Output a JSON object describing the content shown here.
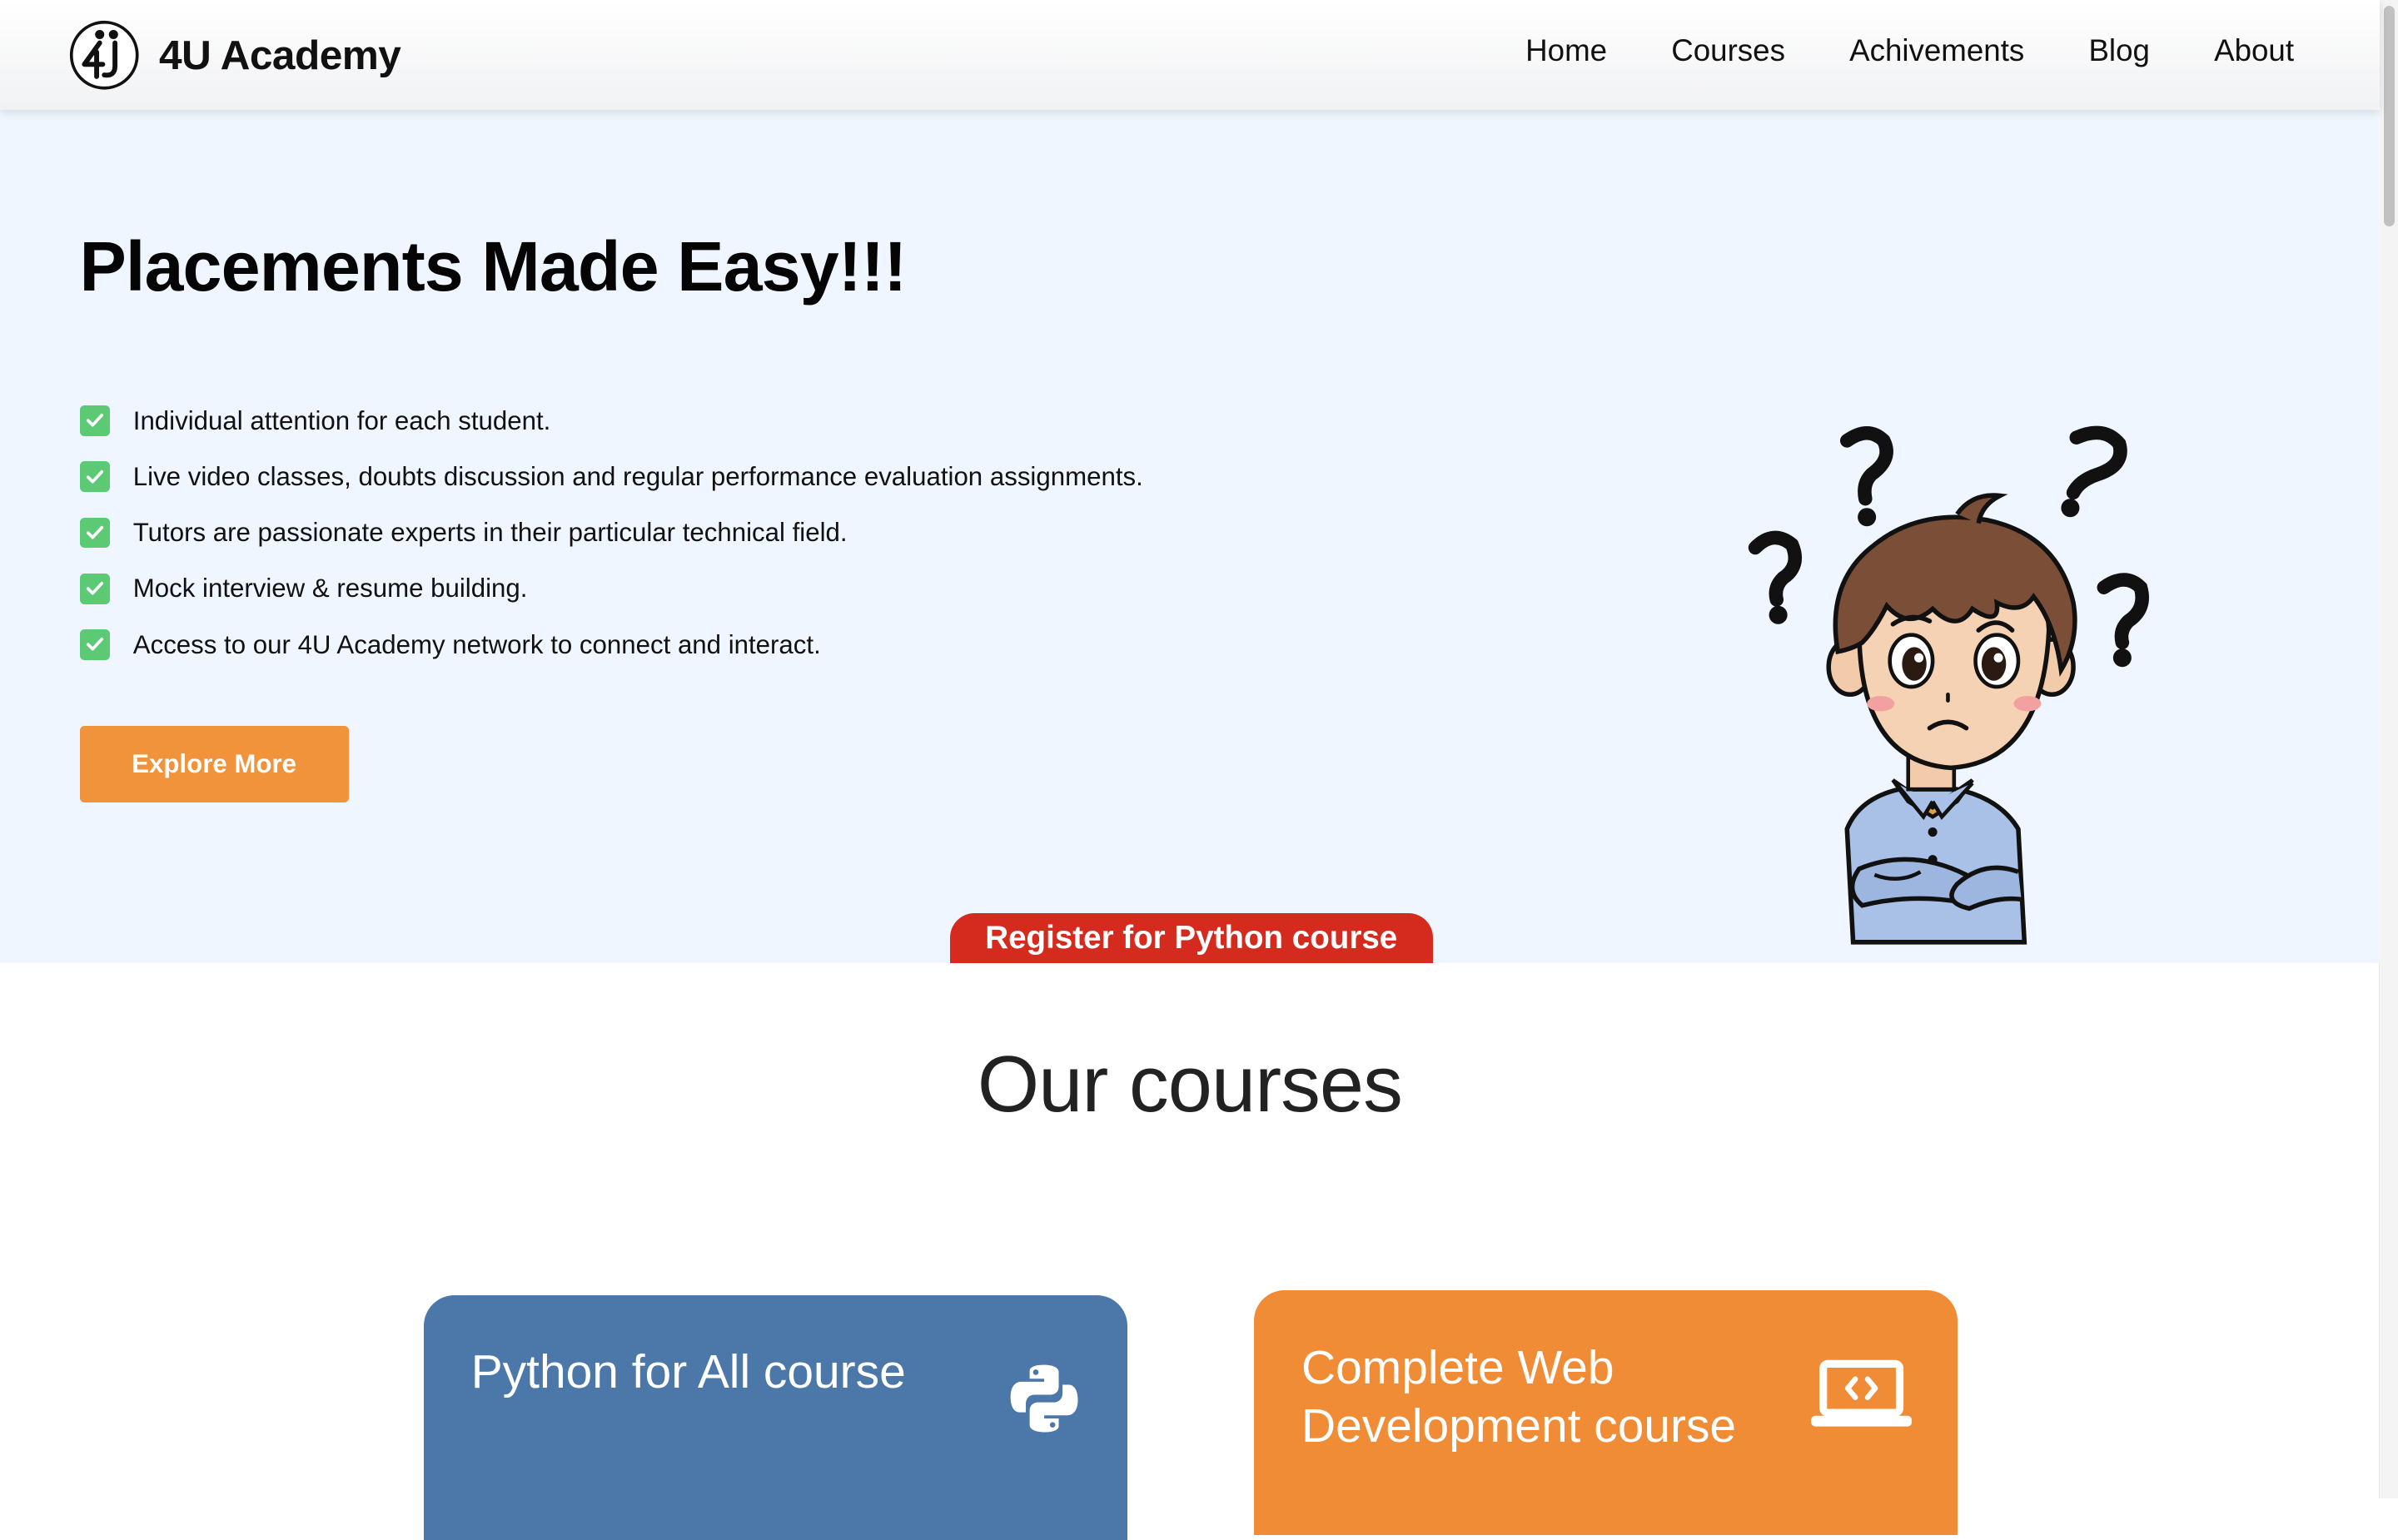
{
  "brand": {
    "name": "4U Academy",
    "logo_icon": "4u-logo-icon"
  },
  "nav": {
    "items": [
      "Home",
      "Courses",
      "Achivements",
      "Blog",
      "About"
    ]
  },
  "hero": {
    "title": "Placements Made Easy!!!",
    "features": [
      "Individual attention for each student.",
      "Live video classes, doubts discussion and regular performance evaluation assignments.",
      "Tutors are passionate experts in their particular technical field.",
      "Mock interview & resume building.",
      "Access to our 4U Academy network to connect and interact."
    ],
    "cta_label": "Explore More",
    "register_label": "Register for Python course"
  },
  "courses": {
    "heading": "Our courses",
    "cards": [
      {
        "title": "Python for All course",
        "icon": "python-icon"
      },
      {
        "title": "Complete Web Development course",
        "icon": "laptop-code-icon"
      }
    ]
  },
  "colors": {
    "hero_bg": "#eff6ff",
    "check_green": "#5cc974",
    "cta_orange": "#f0933a",
    "register_red": "#d52b1e",
    "python_card": "#4b78a8",
    "web_card": "#ef8c35"
  }
}
